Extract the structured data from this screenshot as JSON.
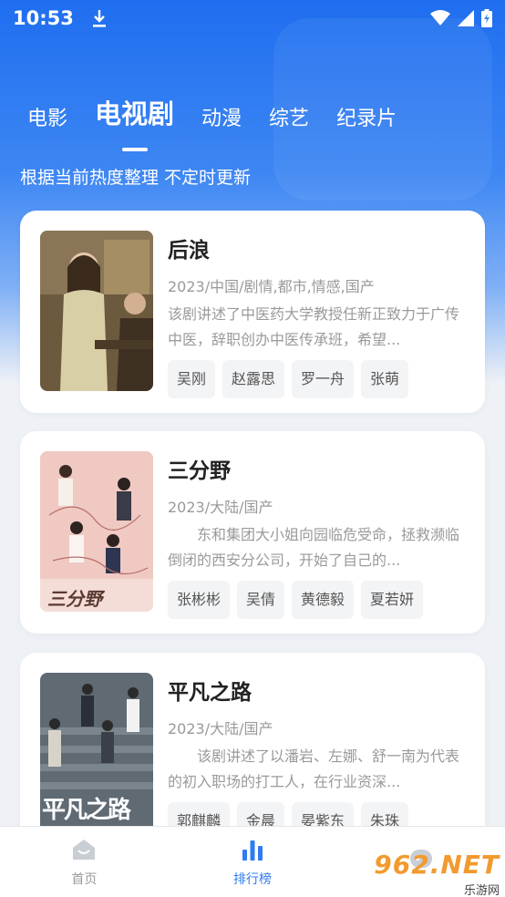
{
  "status_bar": {
    "time": "10:53"
  },
  "tabs": [
    {
      "label": "电影"
    },
    {
      "label": "电视剧"
    },
    {
      "label": "动漫"
    },
    {
      "label": "综艺"
    },
    {
      "label": "纪录片"
    }
  ],
  "active_tab": "电视剧",
  "subtitle": "根据当前热度整理 不定时更新",
  "cards": [
    {
      "title": "后浪",
      "meta": "2023/中国/剧情,都市,情感,国产",
      "desc": "该剧讲述了中医药大学教授任新正致力于广传中医，辞职创办中医传承班，希望...",
      "tags": [
        "吴刚",
        "赵露思",
        "罗一舟",
        "张萌"
      ]
    },
    {
      "title": "三分野",
      "meta": "2023/大陆/国产",
      "desc": "东和集团大小姐向园临危受命，拯救濒临倒闭的西安分公司，开始了自己的...",
      "tags": [
        "张彬彬",
        "吴倩",
        "黄德毅",
        "夏若妍"
      ]
    },
    {
      "title": "平凡之路",
      "meta": "2023/大陆/国产",
      "desc": "该剧讲述了以潘岩、左娜、舒一南为代表的初入职场的打工人，在行业资深...",
      "tags": [
        "郭麒麟",
        "金晨",
        "晏紫东",
        "朱珠"
      ]
    }
  ],
  "poster_titles": {
    "card2": "三分野",
    "card3": "平凡之路"
  },
  "bottom_nav": [
    {
      "label": "首页"
    },
    {
      "label": "排行榜"
    },
    {
      "label": ""
    }
  ],
  "watermark": {
    "logo": "962.NET",
    "text": "乐游网"
  },
  "colors": {
    "accent": "#2f7cf0",
    "hero_top": "#1f6ef0",
    "background": "#eef1f6"
  }
}
